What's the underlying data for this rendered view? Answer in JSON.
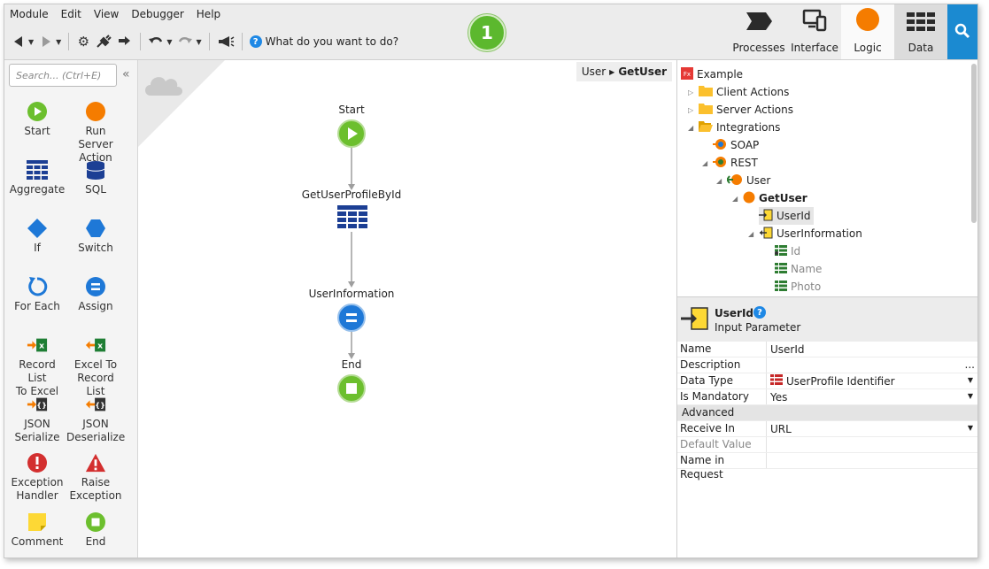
{
  "menu": [
    "Module",
    "Edit",
    "View",
    "Debugger",
    "Help"
  ],
  "toolbar": {
    "search_prompt": "What do you want to do?"
  },
  "badge": "1",
  "tabs": [
    {
      "label": "Processes"
    },
    {
      "label": "Interface"
    },
    {
      "label": "Logic"
    },
    {
      "label": "Data"
    }
  ],
  "toolbox": {
    "search_placeholder": "Search... (Ctrl+E)",
    "items": [
      {
        "line1": "Start",
        "line2": ""
      },
      {
        "line1": "Run Server",
        "line2": "Action"
      },
      {
        "line1": "Aggregate",
        "line2": ""
      },
      {
        "line1": "SQL",
        "line2": ""
      },
      {
        "line1": "If",
        "line2": ""
      },
      {
        "line1": "Switch",
        "line2": ""
      },
      {
        "line1": "For Each",
        "line2": ""
      },
      {
        "line1": "Assign",
        "line2": ""
      },
      {
        "line1": "Record List",
        "line2": "To Excel"
      },
      {
        "line1": "Excel To",
        "line2": "Record List"
      },
      {
        "line1": "JSON",
        "line2": "Serialize"
      },
      {
        "line1": "JSON",
        "line2": "Deserialize"
      },
      {
        "line1": "Exception",
        "line2": "Handler"
      },
      {
        "line1": "Raise",
        "line2": "Exception"
      },
      {
        "line1": "Comment",
        "line2": ""
      },
      {
        "line1": "End",
        "line2": ""
      }
    ]
  },
  "breadcrumb": {
    "parent": "User",
    "current": "GetUser"
  },
  "flow": {
    "start": "Start",
    "aggregate": "GetUserProfileById",
    "assign": "UserInformation",
    "end": "End"
  },
  "tree": [
    {
      "label": "Example"
    },
    {
      "label": "Client Actions"
    },
    {
      "label": "Server Actions"
    },
    {
      "label": "Integrations"
    },
    {
      "label": "SOAP"
    },
    {
      "label": "REST"
    },
    {
      "label": "User"
    },
    {
      "label": "GetUser"
    },
    {
      "label": "UserId"
    },
    {
      "label": "UserInformation"
    },
    {
      "label": "Id"
    },
    {
      "label": "Name"
    },
    {
      "label": "Photo"
    }
  ],
  "props": {
    "title": "UserId",
    "subtitle": "Input Parameter",
    "rows": [
      {
        "key": "Name",
        "value": "UserId"
      },
      {
        "key": "Description",
        "value": "..."
      },
      {
        "key": "Data Type",
        "value": "UserProfile Identifier"
      },
      {
        "key": "Is Mandatory",
        "value": "Yes"
      },
      {
        "key": "Advanced",
        "value": ""
      },
      {
        "key": "Receive In",
        "value": "URL"
      },
      {
        "key": "Default Value",
        "value": ""
      },
      {
        "key": "Name in Request",
        "value": ""
      }
    ]
  },
  "colors": {
    "accent": "#1b8ad1",
    "green": "#6cbf2e",
    "orange": "#f57c00",
    "blue": "#1565c0"
  }
}
